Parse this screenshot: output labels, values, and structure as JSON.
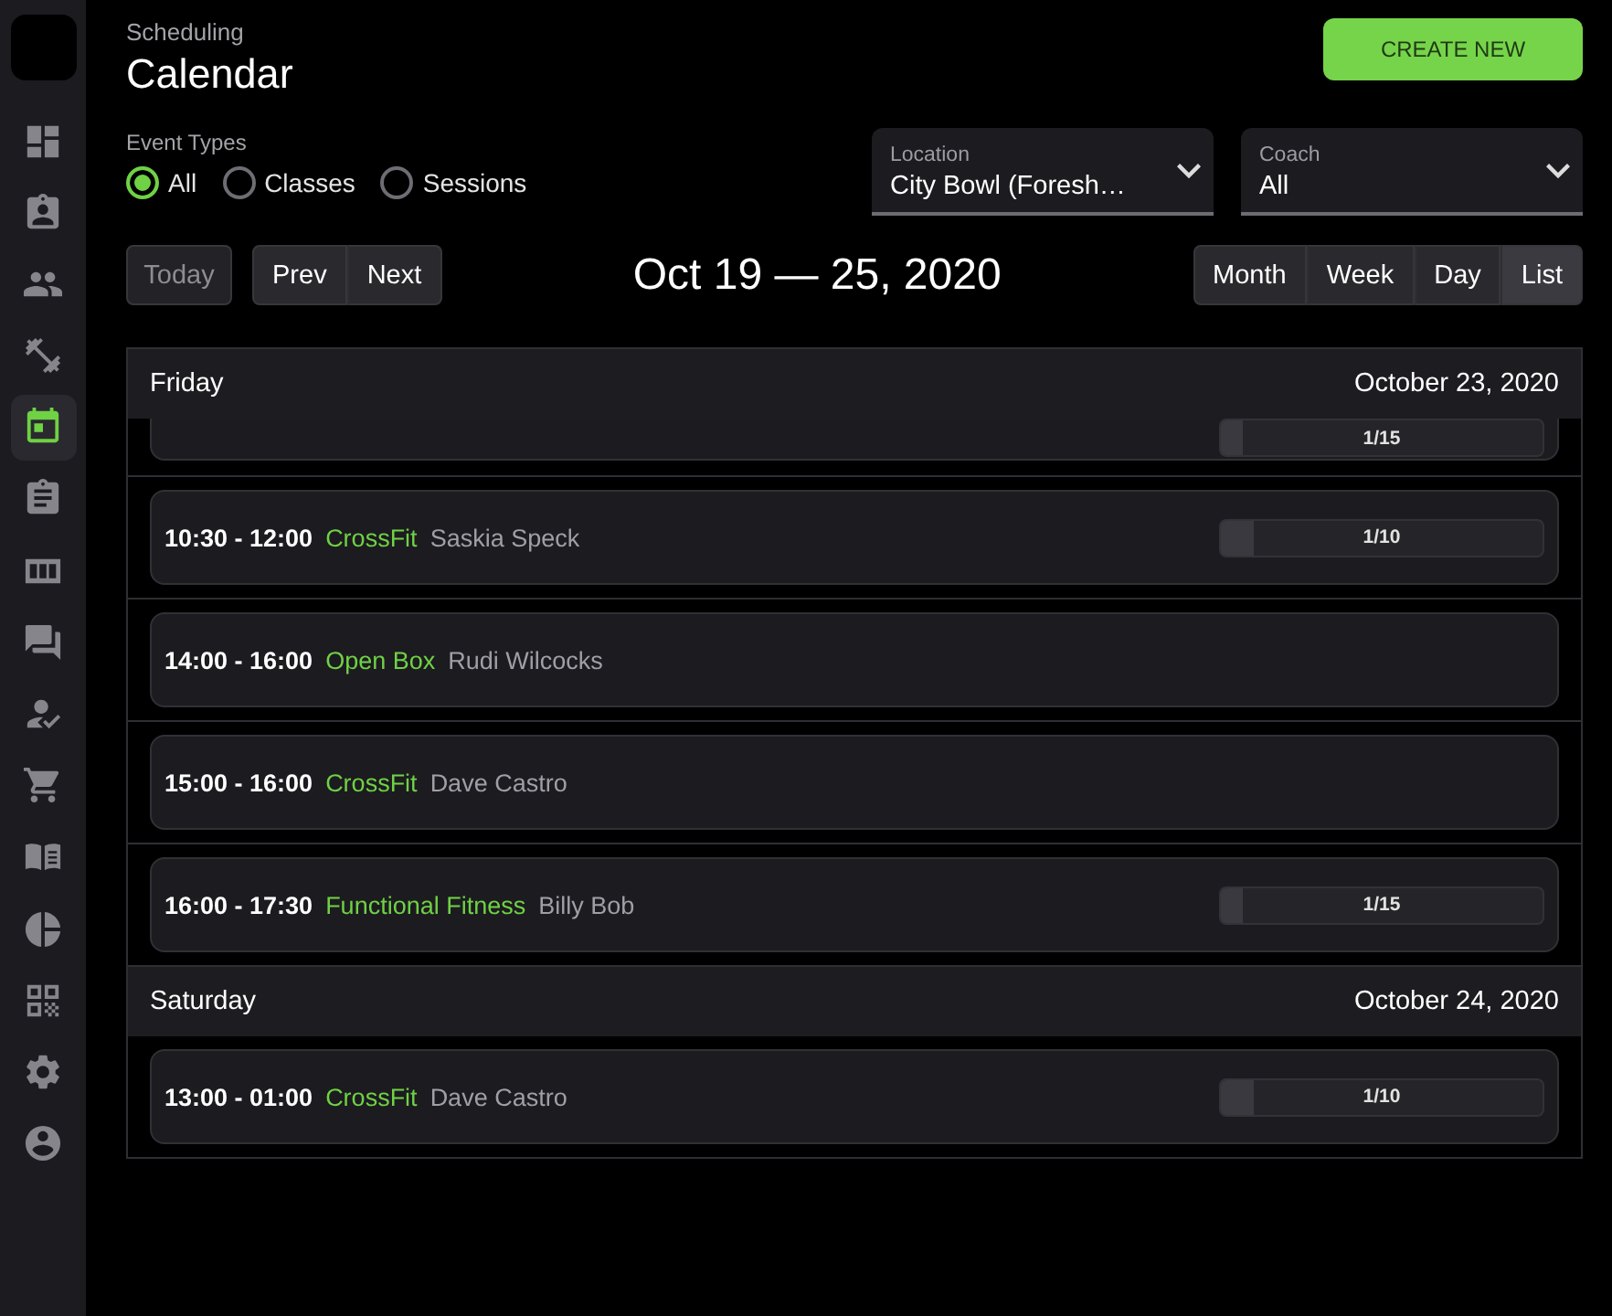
{
  "sidebar": {
    "items": [
      {
        "selected": false
      },
      {
        "selected": false
      },
      {
        "selected": false
      },
      {
        "selected": false
      },
      {
        "selected": true
      },
      {
        "selected": false
      },
      {
        "selected": false
      },
      {
        "selected": false
      },
      {
        "selected": false
      },
      {
        "selected": false
      },
      {
        "selected": false
      },
      {
        "selected": false
      },
      {
        "selected": false
      },
      {
        "selected": false
      },
      {
        "selected": false
      }
    ]
  },
  "header": {
    "section": "Scheduling",
    "title": "Calendar",
    "create_button": "CREATE NEW"
  },
  "event_types": {
    "label": "Event Types",
    "options": [
      {
        "label": "All",
        "selected": true
      },
      {
        "label": "Classes",
        "selected": false
      },
      {
        "label": "Sessions",
        "selected": false
      }
    ]
  },
  "filters": [
    {
      "label": "Location",
      "value": "City Bowl (Foresh…"
    },
    {
      "label": "Coach",
      "value": "All"
    }
  ],
  "toolbar": {
    "today": {
      "label": "Today",
      "disabled": true
    },
    "navigation": [
      "Prev",
      "Next"
    ],
    "range_title": "Oct 19 — 25, 2020",
    "views": [
      {
        "label": "Month",
        "selected": false
      },
      {
        "label": "Week",
        "selected": false
      },
      {
        "label": "Day",
        "selected": false
      },
      {
        "label": "List",
        "selected": true
      }
    ]
  },
  "schedule": [
    {
      "day": "Friday",
      "date": "October 23, 2020",
      "events": [
        {
          "kind": "partial",
          "capacity": {
            "level": 0.067,
            "reading": "1/15"
          }
        },
        {
          "kind": "full",
          "time": "10:30 - 12:00",
          "type": "CrossFit",
          "coach": "Saskia Speck",
          "capacity": {
            "level": 0.1,
            "reading": "1/10"
          }
        },
        {
          "kind": "full",
          "time": "14:00 - 16:00",
          "type": "Open Box",
          "coach": "Rudi Wilcocks"
        },
        {
          "kind": "full",
          "time": "15:00 - 16:00",
          "type": "CrossFit",
          "coach": "Dave Castro"
        },
        {
          "kind": "full",
          "time": "16:00 - 17:30",
          "type": "Functional Fitness",
          "coach": "Billy Bob",
          "capacity": {
            "level": 0.067,
            "reading": "1/15"
          }
        }
      ]
    },
    {
      "day": "Saturday",
      "date": "October 24, 2020",
      "events": [
        {
          "kind": "full",
          "time": "13:00 - 01:00",
          "type": "CrossFit",
          "coach": "Dave Castro",
          "capacity": {
            "level": 0.1,
            "reading": "1/10"
          }
        }
      ]
    }
  ]
}
